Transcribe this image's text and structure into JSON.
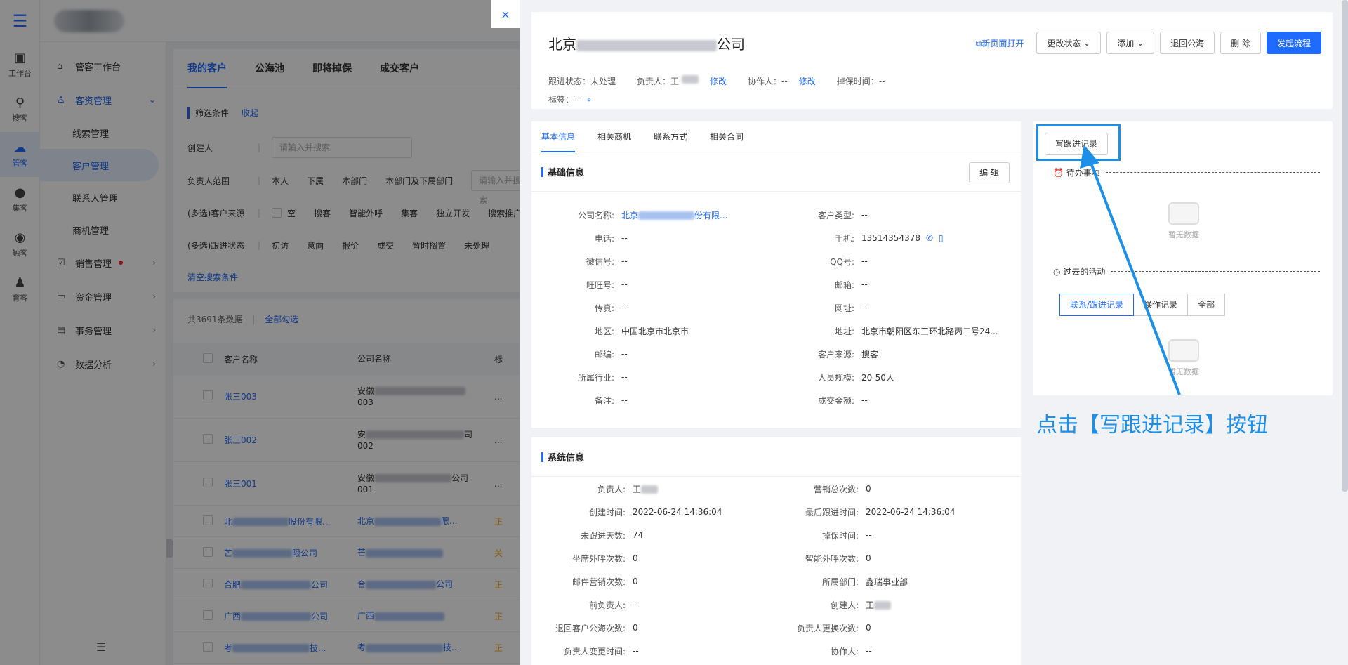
{
  "rail": {
    "items": [
      {
        "label": "工作台",
        "icon": "monitor-icon"
      },
      {
        "label": "搜客",
        "icon": "search-person-icon"
      },
      {
        "label": "管客",
        "icon": "cloud-icon"
      },
      {
        "label": "集客",
        "icon": "group-icon"
      },
      {
        "label": "触客",
        "icon": "headset-icon"
      },
      {
        "label": "育客",
        "icon": "people-icon"
      }
    ]
  },
  "sidebar": {
    "workbench": "管客工作台",
    "customer_mgmt": "客资管理",
    "subs": [
      "线索管理",
      "客户管理",
      "联系人管理",
      "商机管理"
    ],
    "sales": "销售管理",
    "funds": "资金管理",
    "affairs": "事务管理",
    "analysis": "数据分析"
  },
  "main": {
    "tabs": [
      "我的客户",
      "公海池",
      "即将掉保",
      "成交客户"
    ],
    "filter_title": "筛选条件",
    "collapse": "收起",
    "creator_label": "创建人",
    "creator_placeholder": "请输入并搜索",
    "owner_label": "负责人范围",
    "owner_opts": [
      "本人",
      "下属",
      "本部门",
      "本部门及下属部门"
    ],
    "owner_placeholder": "请输入并搜索",
    "source_label": "(多选)客户来源",
    "source_opts": [
      "空",
      "搜客",
      "智能外呼",
      "集客",
      "独立开发",
      "搜索推广"
    ],
    "status_label": "(多选)跟进状态",
    "status_opts": [
      "初访",
      "意向",
      "报价",
      "成交",
      "暂时搁置",
      "未处理"
    ],
    "clear": "清空搜索条件",
    "count": "共3691条数据",
    "select_all": "全部勾选",
    "col_name": "客户名称",
    "col_company": "公司名称",
    "col_tag": "标",
    "rows": [
      {
        "name": "张三003",
        "co_prefix": "安徽",
        "co_suffix": "003"
      },
      {
        "name": "张三002",
        "co_prefix": "安",
        "co_suffix": "002",
        "co_tail": "司"
      },
      {
        "name": "张三001",
        "co_prefix": "安徽",
        "co_suffix": "001",
        "co_tail": "公司"
      },
      {
        "name": "北",
        "name_tail": "股份有限...",
        "co_prefix": "北京",
        "co_tail": "限..."
      },
      {
        "name": "芒",
        "name_tail": "限公司",
        "co_prefix": "芒"
      },
      {
        "name": "合肥",
        "name_tail": "公司",
        "co_prefix": "合",
        "co_tail": "公司"
      },
      {
        "name": "广西",
        "name_tail": "公司",
        "co_prefix": "广西"
      },
      {
        "name": "考",
        "name_tail": "技...",
        "co_prefix": "考",
        "co_tail": "技..."
      }
    ]
  },
  "drawer": {
    "close": "×",
    "title_prefix": "北京",
    "title_suffix": "公司",
    "follow_status": "跟进状态：未处理",
    "owner": "负责人：王",
    "owner_edit": "修改",
    "assist": "协作人：--",
    "assist_edit": "修改",
    "drop_time": "掉保时间：--",
    "tags": "标签：--",
    "open_new": "新页面打开",
    "change_status": "更改状态",
    "add": "添加",
    "return_pool": "退回公海",
    "delete": "删 除",
    "start_flow": "发起流程",
    "tabs": [
      "基本信息",
      "相关商机",
      "联系方式",
      "相关合同"
    ],
    "basic_title": "基础信息",
    "edit": "编 辑",
    "basic_left": [
      {
        "label": "公司名称:",
        "value": "北京",
        "tail": "份有限..."
      },
      {
        "label": "电话:",
        "value": "--"
      },
      {
        "label": "微信号:",
        "value": "--"
      },
      {
        "label": "旺旺号:",
        "value": "--"
      },
      {
        "label": "传真:",
        "value": "--"
      },
      {
        "label": "地区:",
        "value": "中国北京市北京市"
      },
      {
        "label": "邮编:",
        "value": "--"
      },
      {
        "label": "所属行业:",
        "value": "--"
      },
      {
        "label": "备注:",
        "value": "--"
      }
    ],
    "basic_right": [
      {
        "label": "客户类型:",
        "value": "--"
      },
      {
        "label": "手机:",
        "value": "13514354378"
      },
      {
        "label": "QQ号:",
        "value": "--"
      },
      {
        "label": "邮箱:",
        "value": "--"
      },
      {
        "label": "网址:",
        "value": "--"
      },
      {
        "label": "地址:",
        "value": "北京市朝阳区东三环北路丙二号24..."
      },
      {
        "label": "客户来源:",
        "value": "搜客"
      },
      {
        "label": "人员规模:",
        "value": "20-50人"
      },
      {
        "label": "成交金额:",
        "value": "--"
      }
    ],
    "sys_title": "系统信息",
    "sys_left": [
      {
        "label": "负责人:",
        "value": "王"
      },
      {
        "label": "创建时间:",
        "value": "2022-06-24 14:36:04"
      },
      {
        "label": "未跟进天数:",
        "value": "74"
      },
      {
        "label": "坐席外呼次数:",
        "value": "0"
      },
      {
        "label": "邮件营销次数:",
        "value": "0"
      },
      {
        "label": "前负责人:",
        "value": "--"
      },
      {
        "label": "退回客户公海次数:",
        "value": "0"
      },
      {
        "label": "负责人变更时间:",
        "value": "--"
      }
    ],
    "sys_right": [
      {
        "label": "营销总次数:",
        "value": "0"
      },
      {
        "label": "最后跟进时间:",
        "value": "2022-06-24 14:36:04"
      },
      {
        "label": "掉保时间:",
        "value": "--"
      },
      {
        "label": "智能外呼次数:",
        "value": "0"
      },
      {
        "label": "所属部门:",
        "value": "鑫瑞事业部"
      },
      {
        "label": "创建人:",
        "value": "王"
      },
      {
        "label": "负责人更换次数:",
        "value": "0"
      },
      {
        "label": "协作人:",
        "value": "--"
      }
    ],
    "write_record": "写跟进记录",
    "todo": "待办事项",
    "empty_text": "暂无数据",
    "past": "过去的活动",
    "seg": [
      "联系/跟进记录",
      "操作记录",
      "全部"
    ]
  },
  "annotation": "点击【写跟进记录】按钮",
  "colors": {
    "accent": "#1f6bff",
    "annot": "#1e8fe6"
  }
}
